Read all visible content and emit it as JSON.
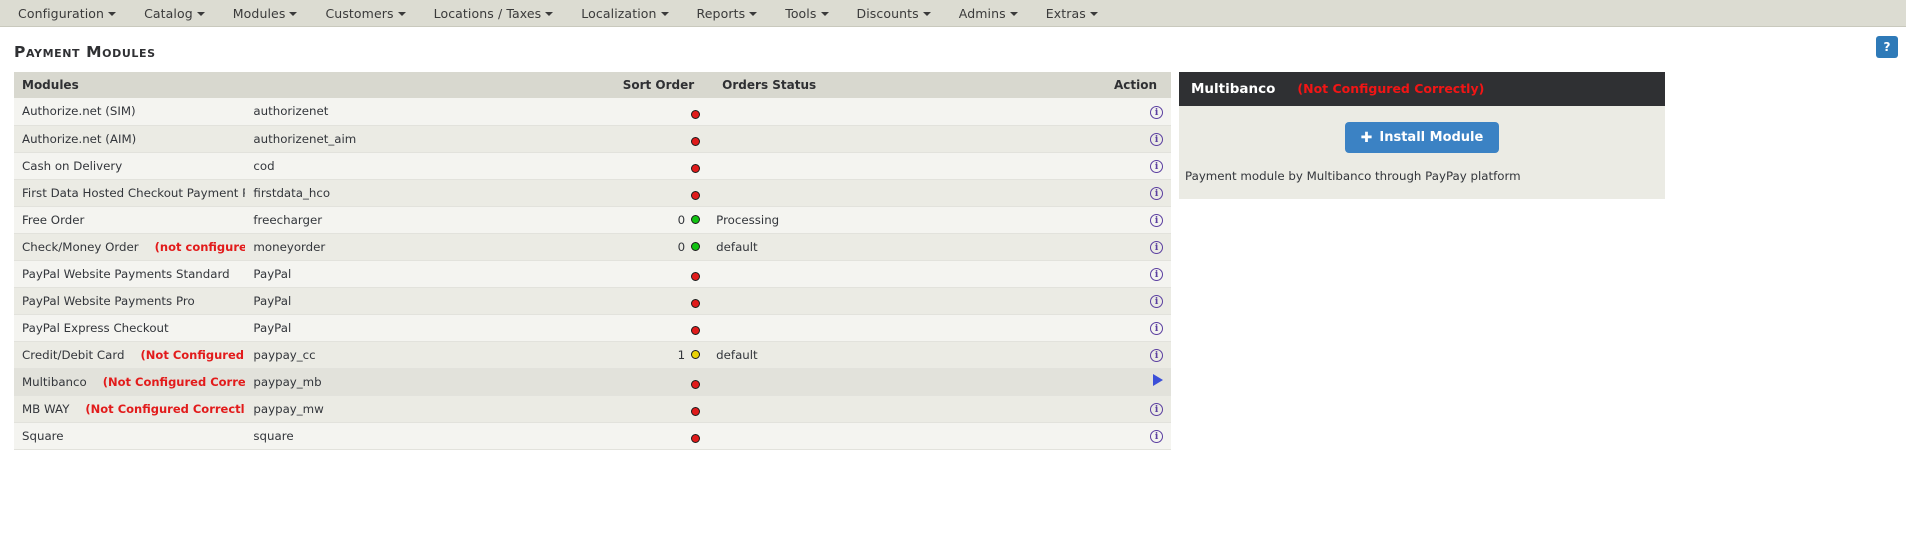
{
  "menu": {
    "items": [
      {
        "label": "Configuration",
        "caret": "chevron-down-icon"
      },
      {
        "label": "Catalog",
        "caret": "chevron-down-icon"
      },
      {
        "label": "Modules",
        "caret": "chevron-down-icon"
      },
      {
        "label": "Customers",
        "caret": "chevron-down-icon"
      },
      {
        "label": "Locations / Taxes",
        "caret": "chevron-down-icon"
      },
      {
        "label": "Localization",
        "caret": "chevron-down-icon"
      },
      {
        "label": "Reports",
        "caret": "chevron-down-icon"
      },
      {
        "label": "Tools",
        "caret": "chevron-down-icon"
      },
      {
        "label": "Discounts",
        "caret": "chevron-down-icon"
      },
      {
        "label": "Admins",
        "caret": "chevron-down-icon"
      },
      {
        "label": "Extras",
        "caret": "chevron-down-icon"
      }
    ]
  },
  "help": {
    "label": "?"
  },
  "page": {
    "title": "Payment Modules"
  },
  "table": {
    "headers": {
      "modules": "Modules",
      "sort_order": "Sort Order",
      "orders_status": "Orders Status",
      "action": "Action"
    },
    "rows": [
      {
        "name": "Authorize.net (SIM)",
        "note": "",
        "code": "authorizenet",
        "sort": "",
        "dot": "red",
        "status": "",
        "action": "info-icon",
        "selected": false
      },
      {
        "name": "Authorize.net (AIM)",
        "note": "",
        "code": "authorizenet_aim",
        "sort": "",
        "dot": "red",
        "status": "",
        "action": "info-icon",
        "selected": false
      },
      {
        "name": "Cash on Delivery",
        "note": "",
        "code": "cod",
        "sort": "",
        "dot": "red",
        "status": "",
        "action": "info-icon",
        "selected": false
      },
      {
        "name": "First Data Hosted Checkout Payment Pages",
        "note": "",
        "code": "firstdata_hco",
        "sort": "",
        "dot": "red",
        "status": "",
        "action": "info-icon",
        "selected": false
      },
      {
        "name": "Free Order",
        "note": "",
        "code": "freecharger",
        "sort": "0",
        "dot": "green",
        "status": "Processing",
        "action": "info-icon",
        "selected": false
      },
      {
        "name": "Check/Money Order",
        "note": "(not configured - needs pay-to)",
        "code": "moneyorder",
        "sort": "0",
        "dot": "green",
        "status": "default",
        "action": "info-icon",
        "selected": false
      },
      {
        "name": "PayPal Website Payments Standard",
        "note": "",
        "code": "PayPal",
        "sort": "",
        "dot": "red",
        "status": "",
        "action": "info-icon",
        "selected": false
      },
      {
        "name": "PayPal Website Payments Pro",
        "note": "",
        "code": "PayPal",
        "sort": "",
        "dot": "red",
        "status": "",
        "action": "info-icon",
        "selected": false
      },
      {
        "name": "PayPal Express Checkout",
        "note": "",
        "code": "PayPal",
        "sort": "",
        "dot": "red",
        "status": "",
        "action": "info-icon",
        "selected": false
      },
      {
        "name": "Credit/Debit Card",
        "note": "(Not Configured Correctly)",
        "code": "paypay_cc",
        "sort": "1",
        "dot": "yellow",
        "status": "default",
        "action": "info-icon",
        "selected": false
      },
      {
        "name": "Multibanco",
        "note": "(Not Configured Correctly)",
        "code": "paypay_mb",
        "sort": "",
        "dot": "red",
        "status": "",
        "action": "play-icon",
        "selected": true
      },
      {
        "name": "MB WAY",
        "note": "(Not Configured Correctly)",
        "code": "paypay_mw",
        "sort": "",
        "dot": "red",
        "status": "",
        "action": "info-icon",
        "selected": false
      },
      {
        "name": "Square",
        "note": "",
        "code": "square",
        "sort": "",
        "dot": "red",
        "status": "",
        "action": "info-icon",
        "selected": false
      }
    ]
  },
  "panel": {
    "title": "Multibanco",
    "warning": "(Not Configured Correctly)",
    "install_label": "Install Module",
    "install_icon": "plus-icon",
    "description": "Payment module by Multibanco through PayPay platform"
  },
  "colors": {
    "accent_blue": "#3b82c4",
    "warning_red": "#e21b1b",
    "panel_dark": "#2f3033",
    "dot_red": "#e01b1b",
    "dot_green": "#11c211",
    "dot_yellow": "#ead206"
  }
}
